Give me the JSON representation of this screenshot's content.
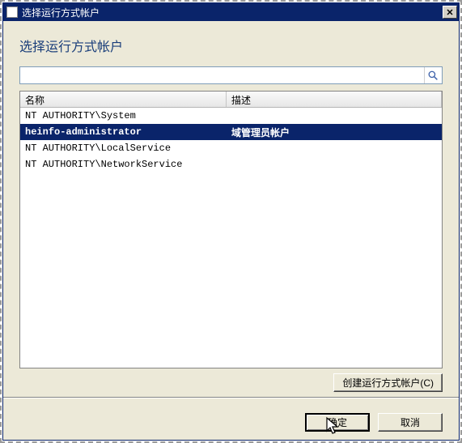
{
  "window": {
    "title": "选择运行方式帐户"
  },
  "heading": "选择运行方式帐户",
  "search": {
    "value": "",
    "placeholder": ""
  },
  "columns": {
    "name": "名称",
    "desc": "描述"
  },
  "rows": [
    {
      "name": "NT AUTHORITY\\System",
      "desc": "",
      "selected": false
    },
    {
      "name": "heinfo-administrator",
      "desc": "域管理员帐户",
      "selected": true
    },
    {
      "name": "NT AUTHORITY\\LocalService",
      "desc": "",
      "selected": false
    },
    {
      "name": "NT AUTHORITY\\NetworkService",
      "desc": "",
      "selected": false
    }
  ],
  "buttons": {
    "create": "创建运行方式帐户(C)",
    "ok": "确定",
    "cancel": "取消"
  }
}
